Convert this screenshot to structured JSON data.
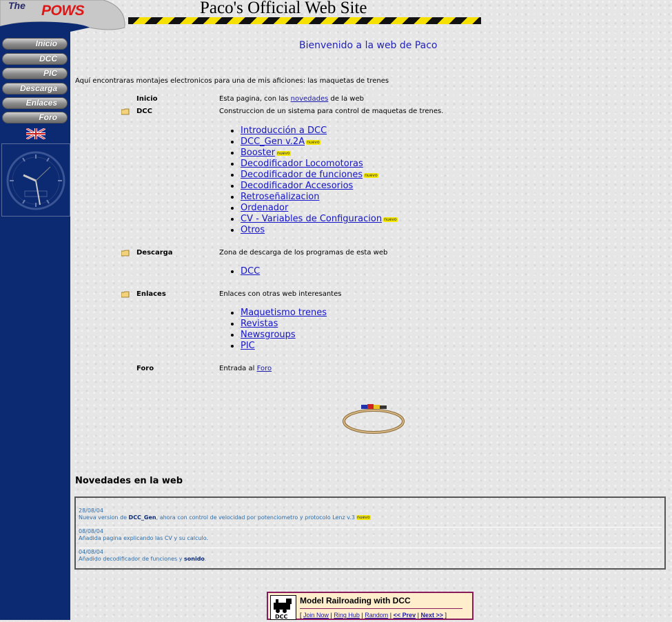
{
  "logo": {
    "the": "The",
    "pows": "POWS"
  },
  "site_title": "Paco's Official Web Site",
  "nav": {
    "items": [
      {
        "label": "Inicio"
      },
      {
        "label": "DCC"
      },
      {
        "label": "PIC"
      },
      {
        "label": "Descarga"
      },
      {
        "label": "Enlaces"
      },
      {
        "label": "Foro"
      }
    ],
    "flag_icon": "uk-flag-icon",
    "clock_icon": "analog-clock-icon"
  },
  "welcome": "Bienvenido a la web de Paco",
  "intro": "Aquí encontraras montajes electronicos para una de mis aficiones: las maquetas de trenes",
  "new_badge": "nuevo",
  "sections": {
    "inicio": {
      "label": "Inicio",
      "desc_pre": "Esta pagina, con las ",
      "desc_link": "novedades",
      "desc_post": " de la web"
    },
    "dcc": {
      "label": "DCC",
      "desc": "Construccion de un sistema para control de maquetas de trenes.",
      "links": [
        "Introducción a DCC",
        "DCC_Gen v.2A",
        "Booster",
        "Decodificador Locomotoras",
        "Decodificador de funciones",
        "Decodificador Accesorios",
        "Retroseñalizacion",
        "Ordenador",
        "CV - Variables de Configuracion",
        "Otros"
      ]
    },
    "descarga": {
      "label": "Descarga",
      "desc": "Zona de descarga de los programas de esta web",
      "links": [
        "DCC"
      ]
    },
    "enlaces": {
      "label": "Enlaces",
      "desc": "Enlaces con otras web interesantes",
      "links": [
        "Maquetismo trenes",
        "Revistas",
        "Newsgroups",
        "PIC"
      ]
    },
    "foro": {
      "label": "Foro",
      "desc_pre": "Entrada al ",
      "desc_link": "Foro"
    }
  },
  "news": {
    "title": "Novedades en la web",
    "items": [
      {
        "date": "28/08/04",
        "pre": "Nueva version de ",
        "bold": "DCC_Gen",
        "post": ", ahora con control de velocidad por potenciometro y protocolo Lenz v.3"
      },
      {
        "date": "08/08/04",
        "pre": "Añadida pagina explicando las CV y su calculo.",
        "bold": "",
        "post": ""
      },
      {
        "date": "04/08/04",
        "pre": "Añadido decodificador de funciones y ",
        "bold": "sonido",
        "post": "."
      }
    ]
  },
  "webring": {
    "title": "Model Railroading with DCC",
    "links": [
      "Join Now",
      "Ring Hub",
      "Random",
      "<< Prev",
      "Next >>"
    ]
  },
  "colors": {
    "sidebar": "#0b2a72",
    "link": "#1414c8",
    "welcome": "#2222bb",
    "badge": "#f5e800",
    "pows_red": "#e01515"
  }
}
